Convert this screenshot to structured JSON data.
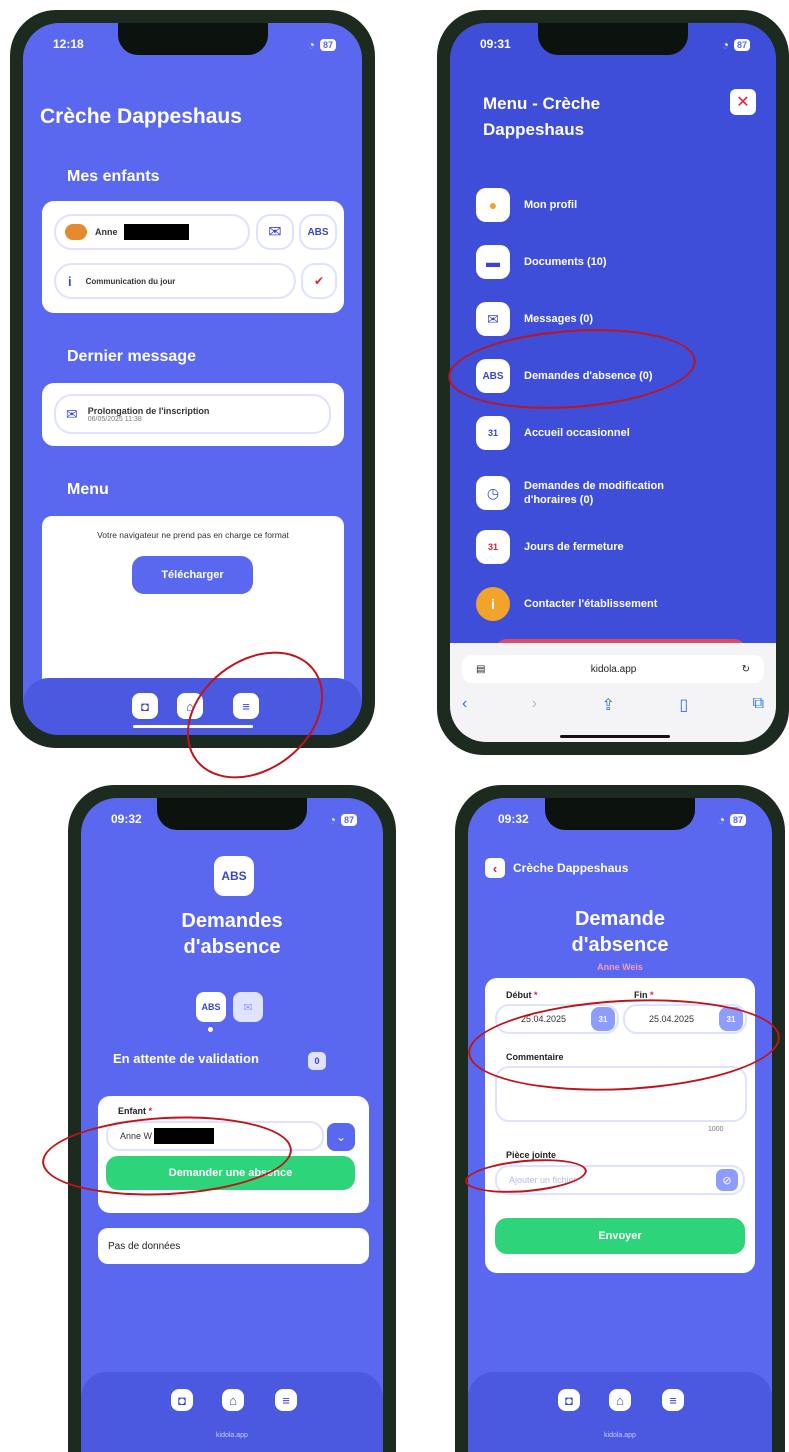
{
  "screen1": {
    "time": "12:18",
    "battery": "87",
    "title": "Crèche Dappeshaus",
    "children_heading": "Mes enfants",
    "child_name": "Anne",
    "abs_label": "ABS",
    "communication_label": "Communication du jour",
    "last_message_heading": "Dernier message",
    "message_title": "Prolongation de l'inscription",
    "message_date": "06/05/2025 11:38",
    "menu_heading": "Menu",
    "unsupported_text": "Votre navigateur ne prend pas en charge ce format",
    "download_button": "Télécharger"
  },
  "screen2": {
    "time": "09:31",
    "battery": "87",
    "title": "Menu - Crèche Dappeshaus",
    "items": [
      {
        "label": "Mon profil",
        "icon": "person-icon"
      },
      {
        "label": "Documents (10)",
        "icon": "folder-icon"
      },
      {
        "label": "Messages (0)",
        "icon": "messages-icon"
      },
      {
        "label": "Demandes d'absence (0)",
        "icon": "abs-icon",
        "icon_text": "ABS"
      },
      {
        "label": "Accueil occasionnel",
        "icon": "calendar-icon",
        "icon_text": "31"
      },
      {
        "label": "Demandes de modification d'horaires (0)",
        "icon": "clock-icon"
      },
      {
        "label": "Jours de fermeture",
        "icon": "calendar-closed-icon",
        "icon_text": "31"
      },
      {
        "label": "Contacter l'établissement",
        "icon": "info-icon",
        "icon_text": "i"
      }
    ],
    "url": "kidola.app"
  },
  "screen3": {
    "time": "09:32",
    "battery": "87",
    "abs_label": "ABS",
    "title": "Demandes d'absence",
    "pending_label": "En attente de validation",
    "pending_count": "0",
    "child_label": "Enfant",
    "child_value": "Anne W",
    "request_button": "Demander une absence",
    "no_data": "Pas de données",
    "url": "kidola.app"
  },
  "screen4": {
    "time": "09:32",
    "battery": "87",
    "back_title": "Crèche Dappeshaus",
    "title": "Demande d'absence",
    "child_name": "Anne Weis",
    "start_label": "Début",
    "start_value": "25.04.2025",
    "end_label": "Fin",
    "end_value": "25.04.2025",
    "comment_label": "Commentaire",
    "char_limit": "1000",
    "attachment_label": "Pièce jointe",
    "attachment_placeholder": "Ajouter un fichier",
    "send_button": "Envoyer",
    "url": "kidola.app"
  },
  "colors": {
    "primary": "#5a68f0",
    "green": "#2dd47a",
    "annotation_red": "#c0141c"
  }
}
